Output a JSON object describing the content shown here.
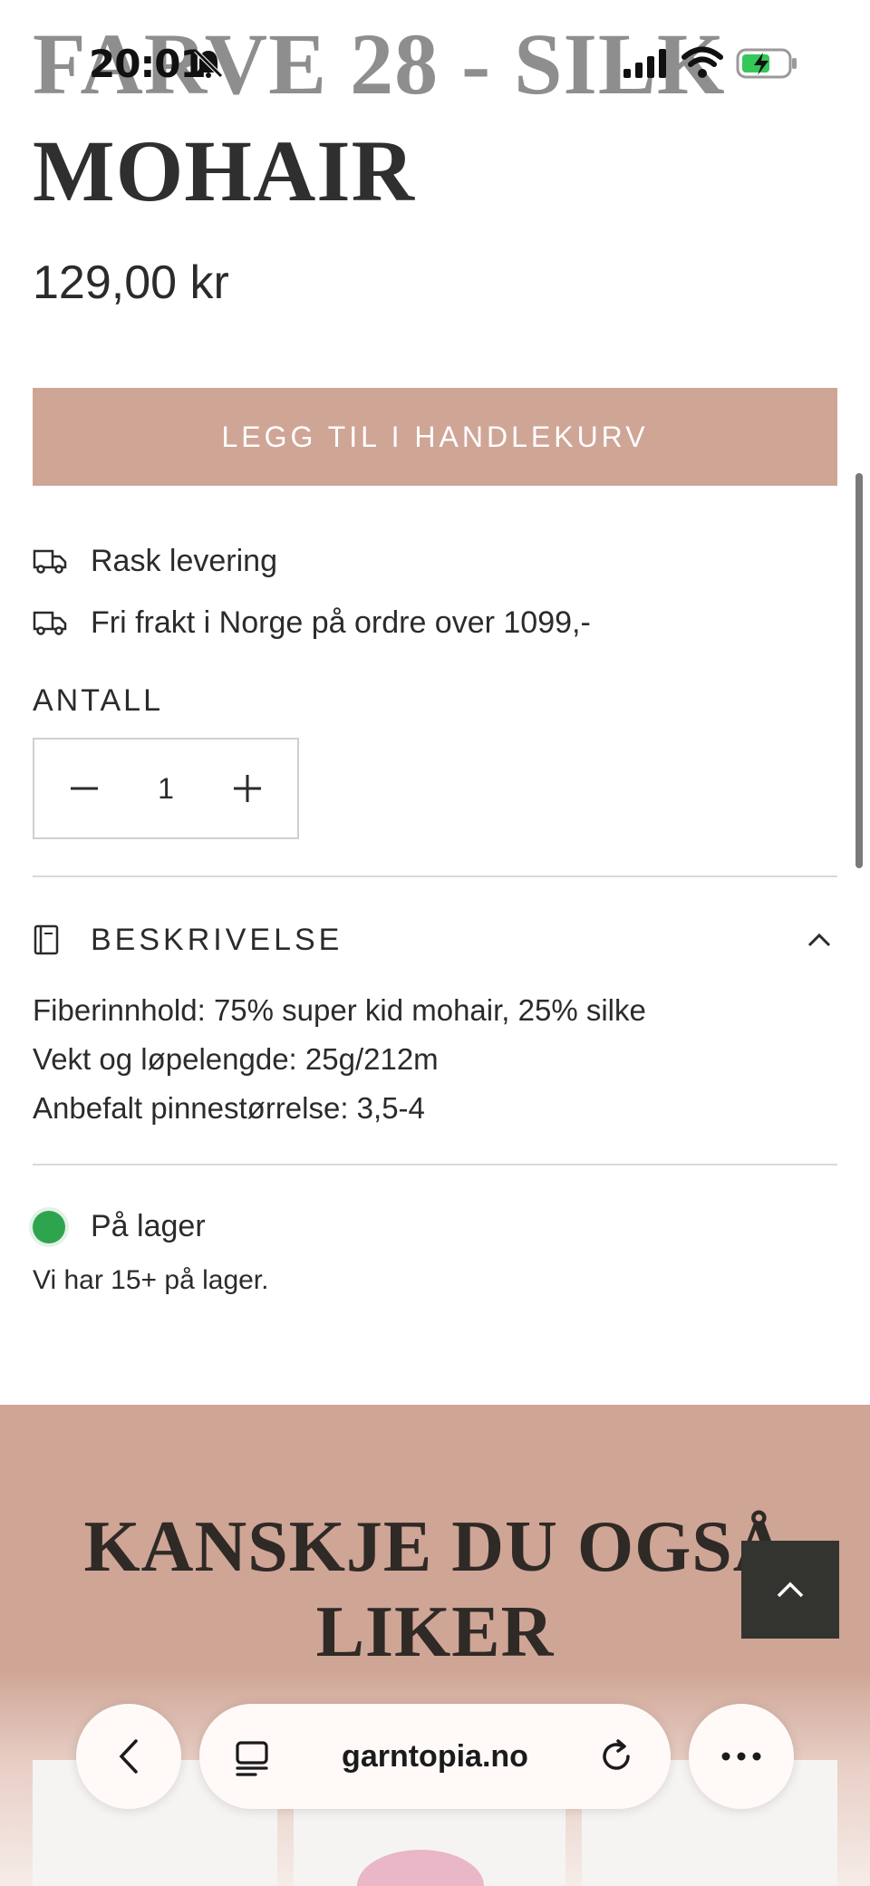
{
  "status_bar": {
    "time": "20:01",
    "icons": [
      "bell-off-icon",
      "signal-icon",
      "wifi-icon",
      "battery-charging-icon"
    ]
  },
  "product": {
    "title_line1": "FARVE 28 - SILK",
    "title_line2": "MOHAIR",
    "price": "129,00 kr",
    "add_to_cart_label": "LEGG TIL I HANDLEKURV"
  },
  "features": [
    {
      "icon": "truck-icon",
      "text": "Rask levering"
    },
    {
      "icon": "truck-icon",
      "text": "Fri frakt i Norge på ordre over 1099,-"
    }
  ],
  "quantity": {
    "label": "ANTALL",
    "value": "1"
  },
  "description": {
    "title": "BESKRIVELSE",
    "lines": [
      "Fiberinnhold: 75% super kid mohair, 25% silke",
      "Vekt og løpelengde: 25g/212m",
      "Anbefalt pinnestørrelse: 3,5-4"
    ]
  },
  "stock": {
    "status": "På lager",
    "note": "Vi har 15+ på lager.",
    "color": "#2ea44f"
  },
  "recommendations": {
    "title_line1": "KANSKJE DU OGSÅ",
    "title_line2": "LIKER"
  },
  "browser": {
    "url": "garntopia.no"
  },
  "colors": {
    "accent": "#cfa596",
    "dark_button": "#33342f"
  }
}
